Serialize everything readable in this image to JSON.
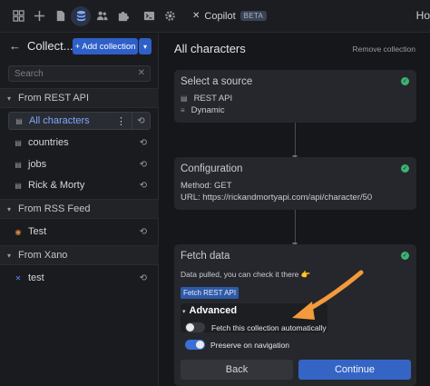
{
  "toolbar": {
    "icons": [
      "pages-icon",
      "add-icon",
      "document-icon",
      "database-icon",
      "users-icon",
      "plugin-icon",
      "terminal-icon",
      "settings-icon"
    ],
    "active_icon": "database-icon",
    "copilot_label": "Copilot",
    "copilot_badge": "BETA",
    "right_text": "Ho"
  },
  "left_panel": {
    "title": "Collect...",
    "add_label": "+ Add collection",
    "search_placeholder": "Search",
    "sections": [
      {
        "label": "From REST API",
        "items": [
          {
            "label": "All characters",
            "selected": true
          },
          {
            "label": "countries",
            "selected": false
          },
          {
            "label": "jobs",
            "selected": false
          },
          {
            "label": "Rick & Morty",
            "selected": false
          }
        ]
      },
      {
        "label": "From RSS Feed",
        "items": [
          {
            "label": "Test",
            "selected": false
          }
        ]
      },
      {
        "label": "From Xano",
        "items": [
          {
            "label": "test",
            "selected": false
          }
        ]
      }
    ]
  },
  "right_panel": {
    "title": "All characters",
    "remove_label": "Remove collection",
    "source_card": {
      "title": "Select a source",
      "lines": [
        "REST API",
        "Dynamic"
      ]
    },
    "config_card": {
      "title": "Configuration",
      "method": "Method: GET",
      "url": "URL: https://rickandmortyapi.com/api/character/50"
    },
    "fetch_card": {
      "title": "Fetch data",
      "note": "Data pulled, you can check it there 👉",
      "fetch_button": "Fetch REST API",
      "advanced_label": "Advanced",
      "toggle_auto_label": "Fetch this collection automatically",
      "toggle_auto_on": false,
      "toggle_preserve_label": "Preserve on navigation",
      "toggle_preserve_on": true,
      "back_label": "Back",
      "continue_label": "Continue"
    }
  },
  "colors": {
    "accent": "#2f5fc8",
    "success": "#3cb371",
    "annotation_arrow": "#f39a3c",
    "background": "#16171b"
  }
}
